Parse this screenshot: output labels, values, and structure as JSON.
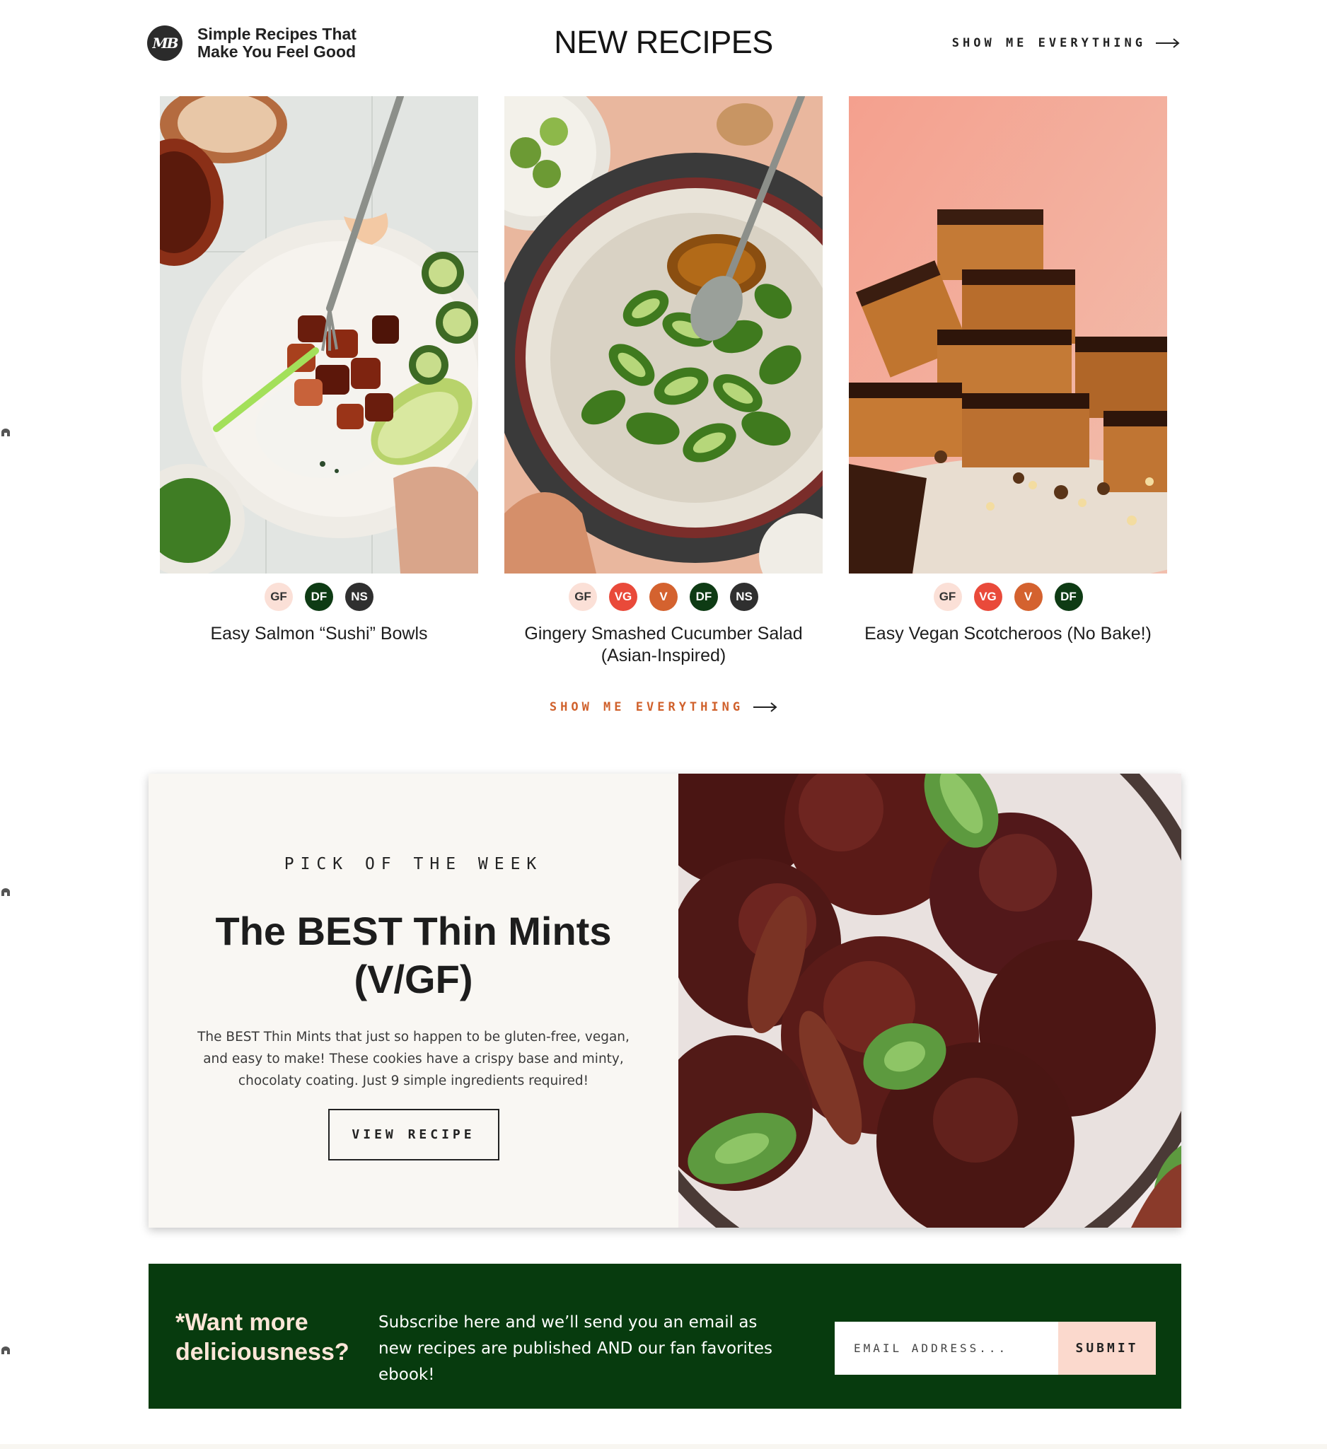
{
  "header": {
    "logo_text": "MB",
    "tagline": "Simple Recipes That Make You Feel Good",
    "section_title": "NEW RECIPES",
    "show_all_label": "SHOW ME EVERYTHING"
  },
  "recipes": [
    {
      "title": "Easy Salmon “Sushi” Bowls",
      "badges": [
        "GF",
        "DF",
        "NS"
      ],
      "image": "salmon-sushi-bowl-photo"
    },
    {
      "title": "Gingery Smashed Cucumber Salad (Asian-Inspired)",
      "badges": [
        "GF",
        "VG",
        "V",
        "DF",
        "NS"
      ],
      "image": "cucumber-salad-photo"
    },
    {
      "title": "Easy Vegan Scotcheroos (No Bake!)",
      "badges": [
        "GF",
        "VG",
        "V",
        "DF"
      ],
      "image": "scotcheroos-photo"
    }
  ],
  "recipes_footer_link": "SHOW ME EVERYTHING",
  "pick": {
    "kicker": "PICK OF THE WEEK",
    "title": "The BEST Thin Mints (V/GF)",
    "description": "The BEST Thin Mints that just so happen to be gluten-free, vegan, and easy to make! These cookies have a crispy base and minty, chocolaty coating. Just 9 simple ingredients required!",
    "button_label": "VIEW RECIPE",
    "image": "thin-mints-photo"
  },
  "newsletter": {
    "heading": "*Want more deliciousness?",
    "text": "Subscribe here and we’ll send you an email as new recipes are published AND our fan favorites ebook!",
    "email_placeholder": "EMAIL ADDRESS...",
    "submit_label": "SUBMIT"
  },
  "colors": {
    "accent": "#d0612c",
    "newsletter_bg": "#073b0e",
    "newsletter_heading": "#fde6d8",
    "pick_bg": "#f9f7f3",
    "badge_gf": "#fbe0d7",
    "badge_vg": "#e94a3a",
    "badge_v": "#d4622f",
    "badge_df": "#0e3b14",
    "badge_ns": "#2f2f2f"
  }
}
